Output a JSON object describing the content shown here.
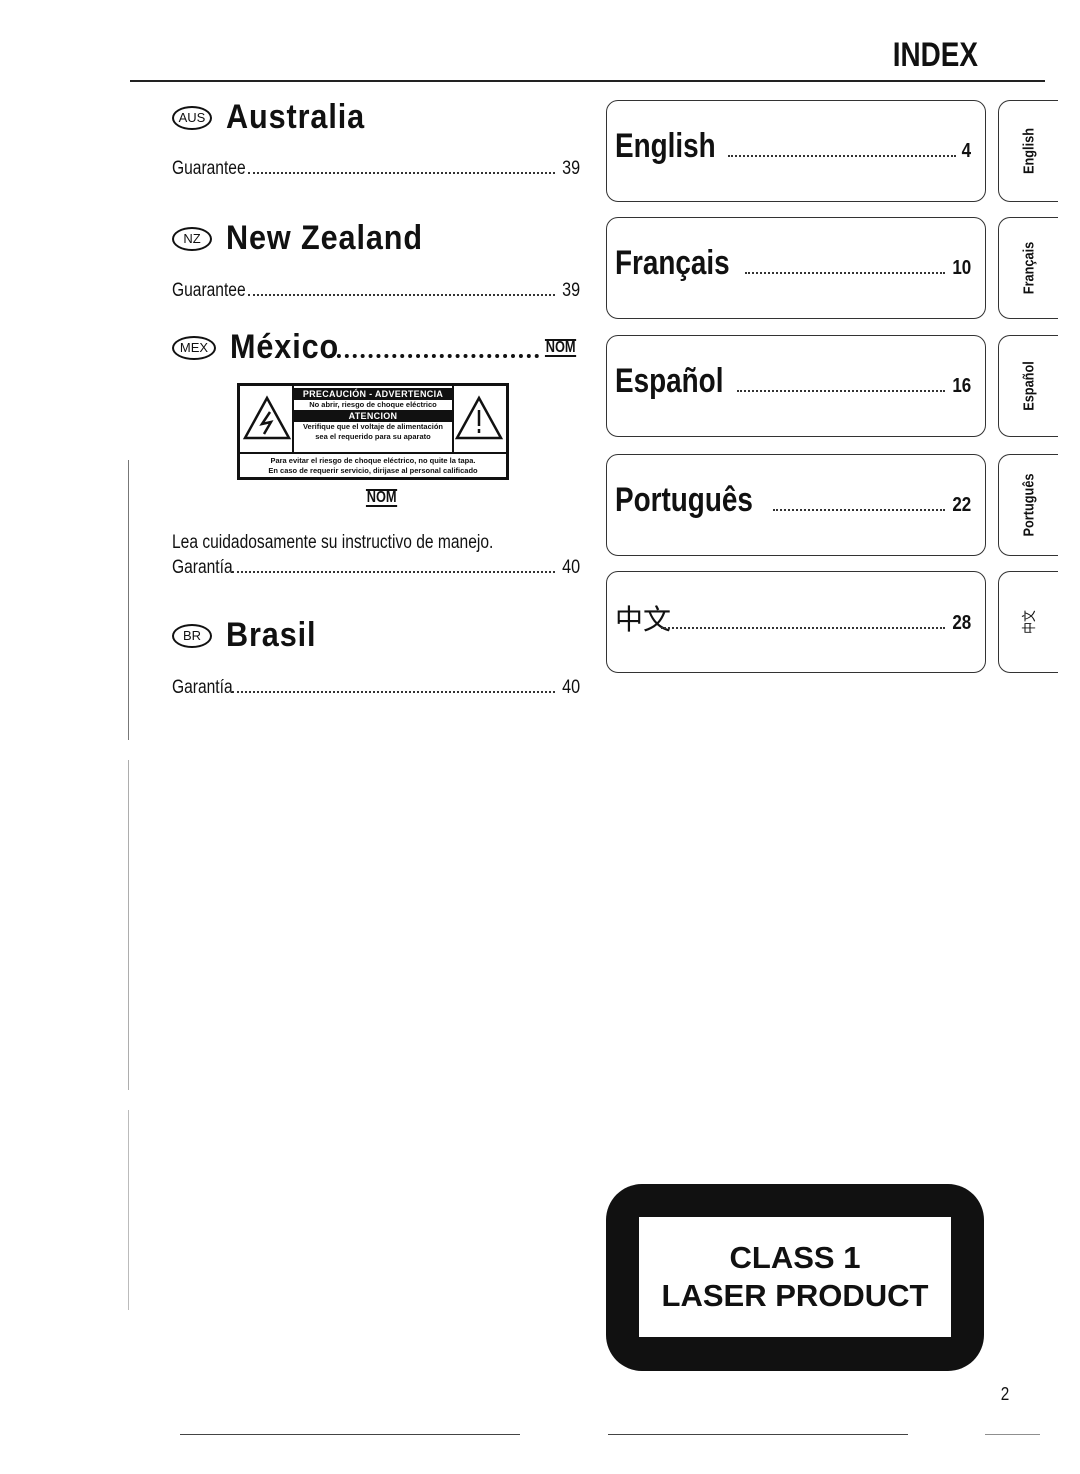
{
  "header": {
    "title": "INDEX"
  },
  "countries": [
    {
      "code": "AUS",
      "name": "Australia",
      "entries": [
        {
          "label": "Guarantee",
          "page": "39"
        }
      ]
    },
    {
      "code": "NZ",
      "name": "New Zealand",
      "entries": [
        {
          "label": "Guarantee",
          "page": "39"
        }
      ]
    },
    {
      "code": "MEX",
      "name": "México",
      "mark": "NOM",
      "note": "Lea cuidadosamente su instructivo de manejo.",
      "entries": [
        {
          "label": "Garantía",
          "page": "40"
        }
      ]
    },
    {
      "code": "BR",
      "name": "Brasil",
      "entries": [
        {
          "label": "Garantía",
          "page": "40"
        }
      ]
    }
  ],
  "warning_label": {
    "heading": "PRECAUCIÓN - ADVERTENCIA",
    "line1": "No abrir, riesgo de choque eléctrico",
    "heading2": "ATENCION",
    "line2": "Verifique que el voltaje de alimentación",
    "line3": "sea el requerido para su aparato",
    "bottom1": "Para evitar el riesgo de choque eléctrico, no quite la tapa.",
    "bottom2": "En caso de requerir servicio, dirijase al personal calificado",
    "mark": "NOM"
  },
  "languages": [
    {
      "name": "English",
      "page": "4",
      "tab": "English"
    },
    {
      "name": "Français",
      "page": "10",
      "tab": "Français"
    },
    {
      "name": "Español",
      "page": "16",
      "tab": "Español"
    },
    {
      "name": "Português",
      "page": "22",
      "tab": "Português"
    },
    {
      "name": "中文",
      "page": "28",
      "tab": "中文"
    }
  ],
  "laser_label": {
    "line1": "CLASS 1",
    "line2": "LASER PRODUCT"
  },
  "footer": {
    "page_number": "2"
  }
}
